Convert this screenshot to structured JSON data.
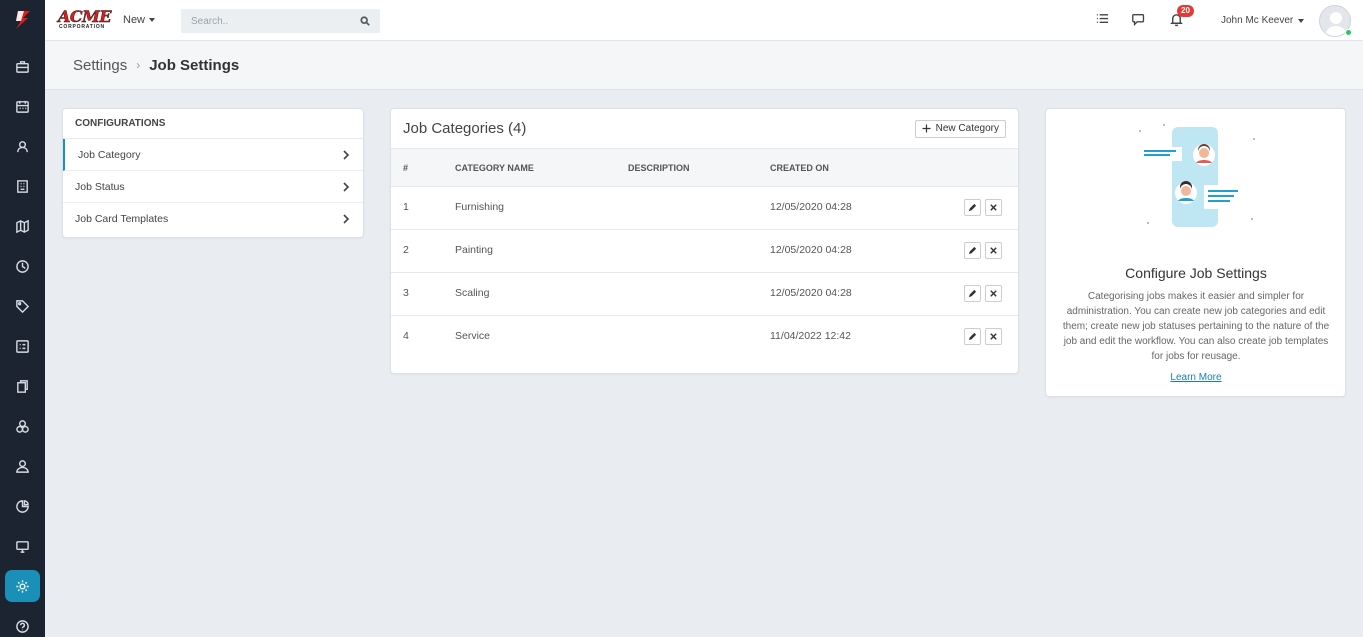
{
  "brand": {
    "name": "ACME",
    "tagline": "CORPORATION",
    "accent": "#e21b1b"
  },
  "topbar": {
    "new_label": "New",
    "search_placeholder": "Search..",
    "notification_count": "20",
    "user_name": "John Mc Keever",
    "icons": [
      "list-icon",
      "chat-icon",
      "bell-icon",
      "user-avatar"
    ]
  },
  "sidebar": {
    "items": [
      {
        "icon": "briefcase-icon"
      },
      {
        "icon": "calendar-icon"
      },
      {
        "icon": "contacts-icon"
      },
      {
        "icon": "building-icon"
      },
      {
        "icon": "map-icon"
      },
      {
        "icon": "clock-icon"
      },
      {
        "icon": "tag-icon"
      },
      {
        "icon": "checklist-icon"
      },
      {
        "icon": "documents-icon"
      },
      {
        "icon": "boxes-icon"
      },
      {
        "icon": "user-icon"
      },
      {
        "icon": "pie-icon"
      },
      {
        "icon": "monitor-icon"
      },
      {
        "icon": "settings-icon",
        "active": true
      },
      {
        "icon": "help-icon"
      }
    ],
    "active_color": "#1a8fb8"
  },
  "breadcrumb": {
    "parent": "Settings",
    "separator": "›",
    "current": "Job Settings"
  },
  "configurations": {
    "title": "CONFIGURATIONS",
    "items": [
      {
        "label": "Job Category",
        "active": true
      },
      {
        "label": "Job Status"
      },
      {
        "label": "Job Card Templates"
      }
    ]
  },
  "job_categories": {
    "title": "Job Categories (4)",
    "new_button": "New Category",
    "columns": [
      "#",
      "CATEGORY NAME",
      "DESCRIPTION",
      "CREATED ON"
    ],
    "rows": [
      {
        "num": "1",
        "name": "Furnishing",
        "description": "",
        "created": "12/05/2020 04:28"
      },
      {
        "num": "2",
        "name": "Painting",
        "description": "",
        "created": "12/05/2020 04:28"
      },
      {
        "num": "3",
        "name": "Scaling",
        "description": "",
        "created": "12/05/2020 04:28"
      },
      {
        "num": "4",
        "name": "Service",
        "description": "",
        "created": "11/04/2022 12:42"
      }
    ]
  },
  "info_panel": {
    "title": "Configure Job Settings",
    "text": "Categorising jobs makes it easier and simpler for administration. You can create new job categories and edit them; create new job statuses pertaining to the nature of the job and edit the workflow. You can also create job templates for jobs for reusage.",
    "link": "Learn More"
  }
}
